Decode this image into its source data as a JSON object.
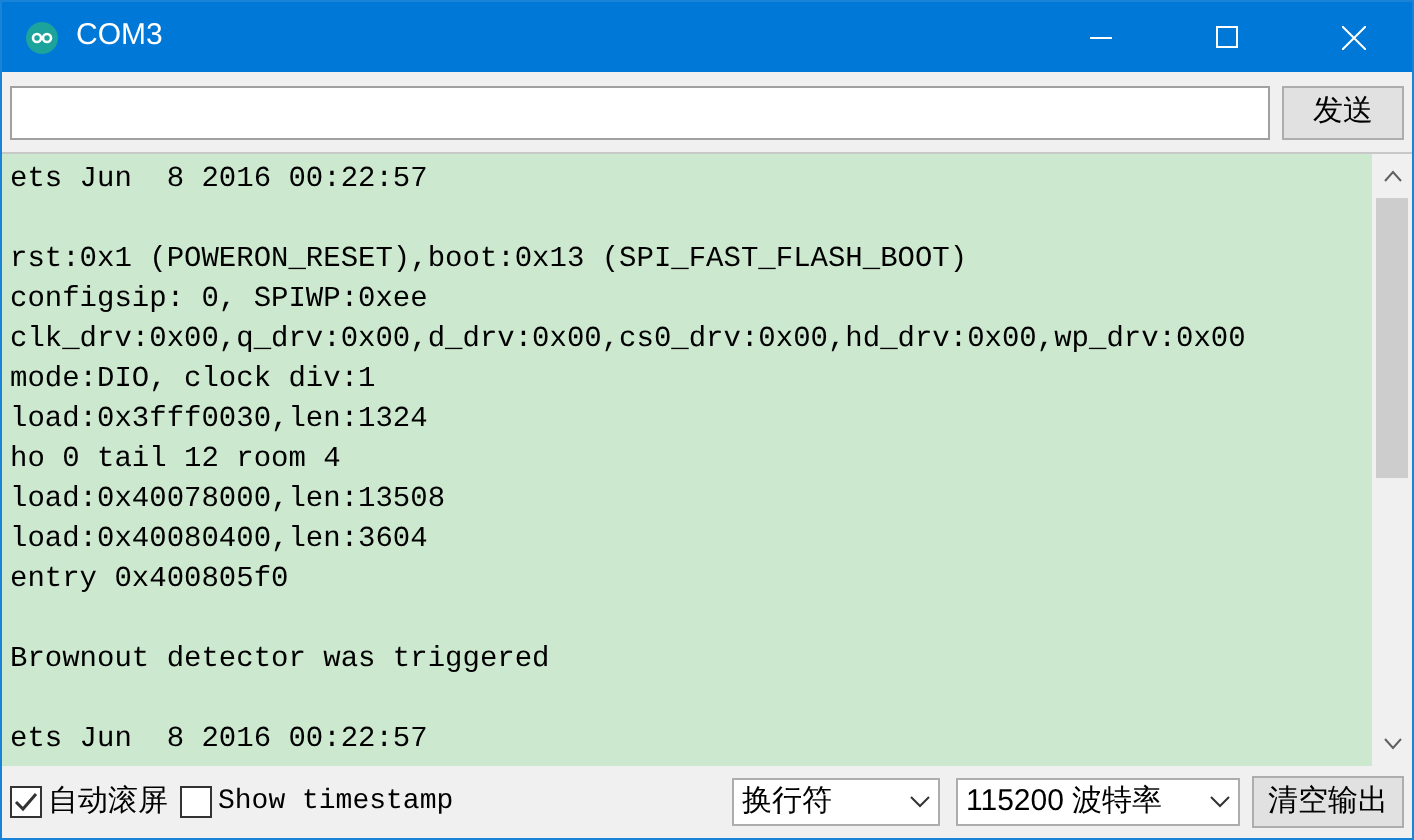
{
  "window": {
    "title": "COM3"
  },
  "send": {
    "button": "发送"
  },
  "log": {
    "blocks": [
      [
        "ets Jun  8 2016 00:22:57"
      ],
      [
        "rst:0x1 (POWERON_RESET),boot:0x13 (SPI_FAST_FLASH_BOOT)",
        "configsip: 0, SPIWP:0xee",
        "clk_drv:0x00,q_drv:0x00,d_drv:0x00,cs0_drv:0x00,hd_drv:0x00,wp_drv:0x00",
        "mode:DIO, clock div:1",
        "load:0x3fff0030,len:1324",
        "ho 0 tail 12 room 4",
        "load:0x40078000,len:13508",
        "load:0x40080400,len:3604",
        "entry 0x400805f0"
      ],
      [
        "Brownout detector was triggered"
      ],
      [
        "ets Jun  8 2016 00:22:57"
      ]
    ]
  },
  "bottom_bar": {
    "options": [
      {
        "label": "自动滚屏",
        "checked": true,
        "kind": "cjk"
      },
      {
        "label": "Show timestamp",
        "checked": false,
        "kind": "mono"
      }
    ],
    "line_ending": "换行符",
    "baud_rate": "115200 波特率",
    "clear_button": "清空输出"
  }
}
